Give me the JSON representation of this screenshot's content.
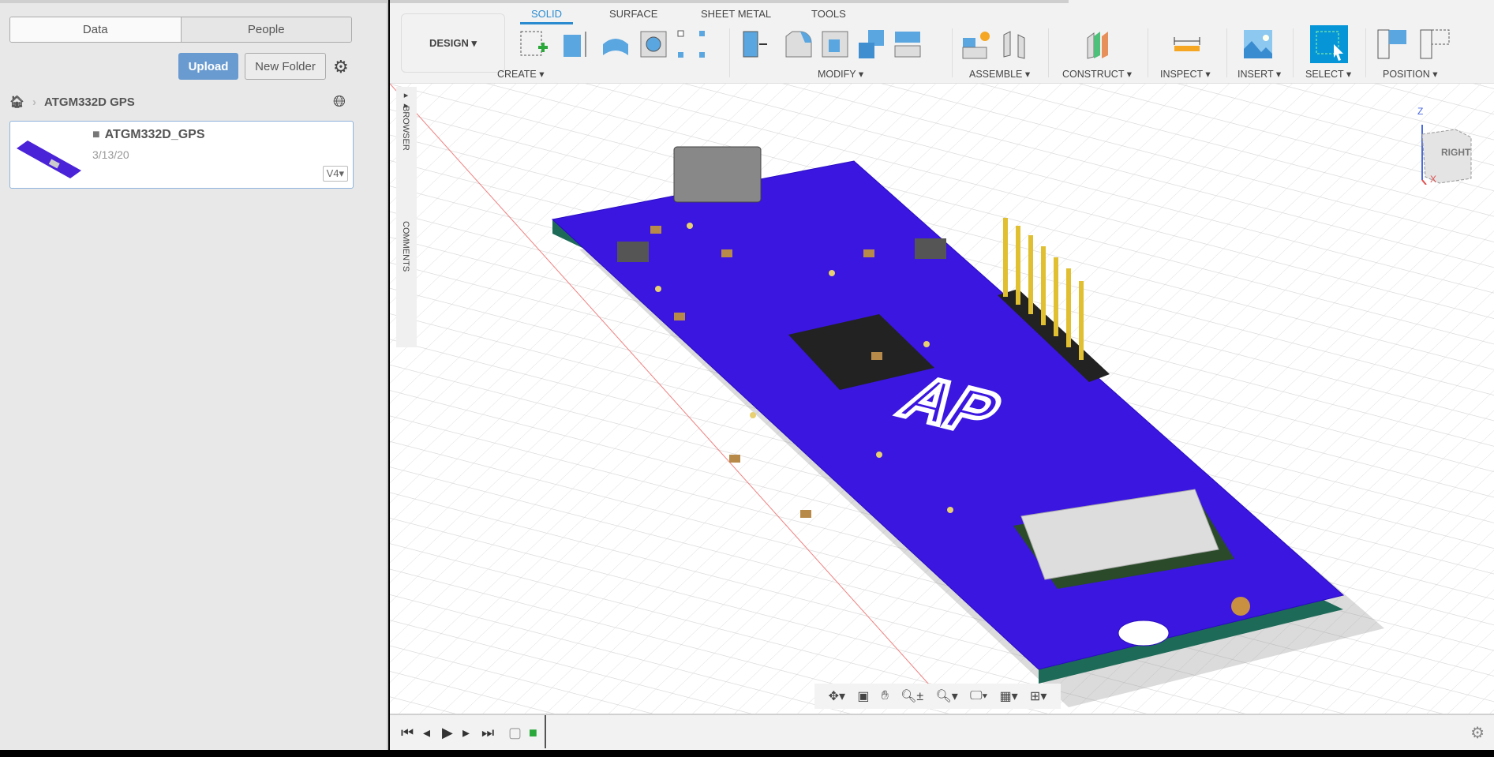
{
  "left_panel": {
    "tabs": [
      "Data",
      "People"
    ],
    "upload_label": "Upload",
    "new_folder_label": "New Folder",
    "breadcrumb": {
      "folder": "ATGM332D GPS"
    },
    "files": [
      {
        "name": "ATGM332D_GPS",
        "date": "3/13/20",
        "version": "V4"
      }
    ]
  },
  "toolbar": {
    "workspace": "DESIGN",
    "tabs": [
      "SOLID",
      "SURFACE",
      "SHEET METAL",
      "TOOLS"
    ],
    "active_tab": "SOLID",
    "groups": [
      "CREATE",
      "MODIFY",
      "ASSEMBLE",
      "CONSTRUCT",
      "INSPECT",
      "INSERT",
      "SELECT",
      "POSITION"
    ]
  },
  "viewport": {
    "side_tabs": [
      "BROWSER",
      "COMMENTS"
    ],
    "viewcube": {
      "face": "RIGHT",
      "axes": [
        "Z",
        "X"
      ]
    },
    "accent": "#0696d7",
    "board_color": "#3a16e0"
  }
}
